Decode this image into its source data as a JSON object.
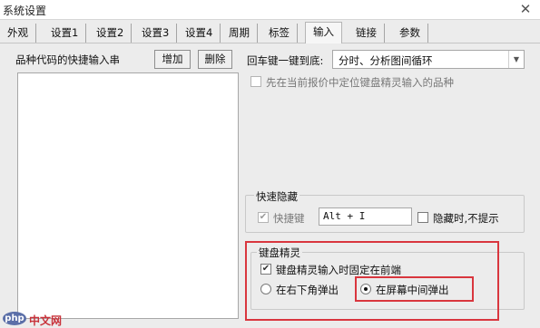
{
  "window": {
    "title": "系统设置",
    "close_glyph": "✕"
  },
  "tabs": [
    "外观",
    "设置1",
    "设置2",
    "设置3",
    "设置4",
    "周期",
    "标签",
    "输入",
    "链接",
    "参数"
  ],
  "active_tab": "输入",
  "left": {
    "label": "品种代码的快捷输入串",
    "add_button": "增加",
    "delete_button": "删除"
  },
  "enter_key": {
    "label": "回车键一键到底:",
    "value": "分时、分析图间循环"
  },
  "locate_keyboard_wizard": {
    "label": "先在当前报价中定位键盘精灵输入的品种",
    "checked": false
  },
  "quick_hide": {
    "title": "快速隐藏",
    "hotkey_label": "快捷键",
    "hotkey_value": "Alt + I",
    "hotkey_checked": true,
    "no_prompt_label": "隐藏时,不提示",
    "no_prompt_checked": false
  },
  "keyboard_wizard": {
    "title": "键盘精灵",
    "fixed_label": "键盘精灵输入时固定在前端",
    "fixed_checked": true,
    "radio_bottom_right": "在右下角弹出",
    "radio_center": "在屏幕中间弹出",
    "selected": "在屏幕中间弹出"
  },
  "watermark": {
    "logo": "php",
    "text": "中文网"
  },
  "colors": {
    "highlight": "#d9363e",
    "background": "#ececec"
  },
  "icons": {
    "close": "close-icon",
    "dropdown": "chevron-down-icon",
    "check": "checkmark-icon"
  }
}
